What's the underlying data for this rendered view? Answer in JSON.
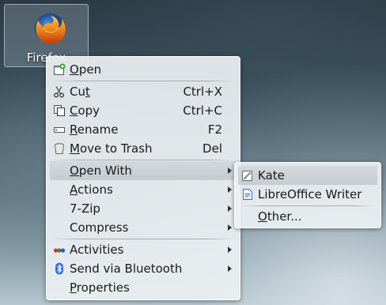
{
  "desktop": {
    "icon_label": "Firefox"
  },
  "context_menu": {
    "items": [
      {
        "pre": "",
        "u": "O",
        "post": "pen",
        "shortcut": "",
        "icon": "open-icon"
      },
      {
        "pre": "Cu",
        "u": "t",
        "post": "",
        "shortcut": "Ctrl+X",
        "icon": "scissors-icon"
      },
      {
        "pre": "",
        "u": "C",
        "post": "opy",
        "shortcut": "Ctrl+C",
        "icon": "copy-icon"
      },
      {
        "pre": "",
        "u": "R",
        "post": "ename",
        "shortcut": "F2",
        "icon": "rename-icon"
      },
      {
        "pre": "",
        "u": "M",
        "post": "ove to Trash",
        "shortcut": "Del",
        "icon": "trash-icon"
      },
      {
        "pre": "",
        "u": "O",
        "post": "pen With",
        "shortcut": "",
        "icon": ""
      },
      {
        "pre": "",
        "u": "A",
        "post": "ctions",
        "shortcut": "",
        "icon": ""
      },
      {
        "pre": "7-Zip",
        "u": "",
        "post": "",
        "shortcut": "",
        "icon": ""
      },
      {
        "pre": "Compress",
        "u": "",
        "post": "",
        "shortcut": "",
        "icon": ""
      },
      {
        "pre": "Activities",
        "u": "",
        "post": "",
        "shortcut": "",
        "icon": "activities-icon"
      },
      {
        "pre": "Send via Bluetooth",
        "u": "",
        "post": "",
        "shortcut": "",
        "icon": "bluetooth-icon"
      },
      {
        "pre": "",
        "u": "P",
        "post": "roperties",
        "shortcut": "",
        "icon": ""
      }
    ]
  },
  "open_with_submenu": {
    "items": [
      {
        "label": "Kate",
        "icon": "kate-icon"
      },
      {
        "label": "LibreOffice Writer",
        "icon": "writer-icon"
      },
      {
        "pre": "",
        "u": "O",
        "post": "ther...",
        "icon": ""
      }
    ]
  },
  "colors": {
    "highlight": "#c8cfd4",
    "menu_bg": "#ecf0f2",
    "firefox_orange": "#e66000",
    "firefox_blue": "#1f4f9c",
    "bluetooth_blue": "#2f6fd8"
  }
}
